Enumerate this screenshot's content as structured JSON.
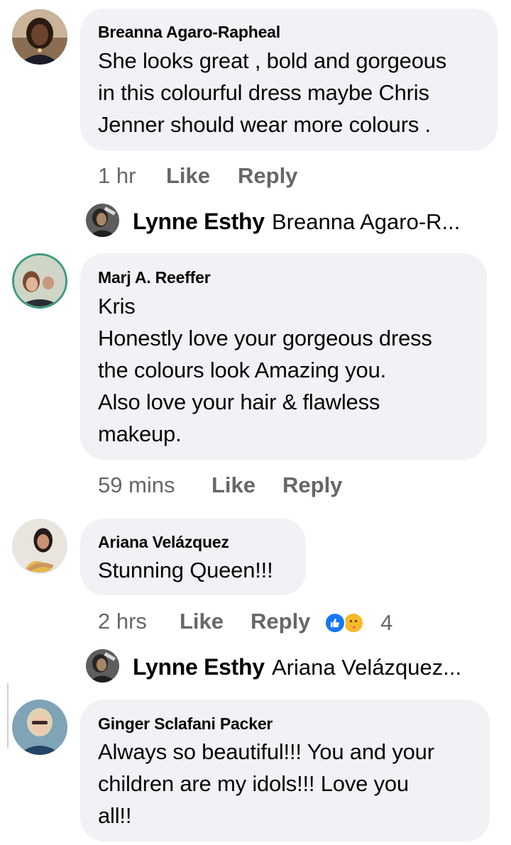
{
  "comments": [
    {
      "author": "Breanna Agaro-Rapheal",
      "text": "She looks great , bold and gorgeous\nin this colourful dress maybe Chris\nJenner should wear more colours .",
      "time": "1 hr",
      "like_label": "Like",
      "reply_label": "Reply",
      "reply_preview": {
        "author": "Lynne Esthy",
        "text": "Breanna Agaro-R..."
      }
    },
    {
      "author": "Marj A. Reeffer",
      "text": "Kris\nHonestly love your gorgeous dress\nthe colours look Amazing you.\nAlso love your hair & flawless\nmakeup.",
      "time": "59 mins",
      "like_label": "Like",
      "reply_label": "Reply"
    },
    {
      "author": "Ariana Velázquez",
      "text": "Stunning Queen!!!",
      "time": "2 hrs",
      "like_label": "Like",
      "reply_label": "Reply",
      "reaction_count": "4",
      "reactions": [
        "like-icon",
        "care-icon"
      ],
      "reply_preview": {
        "author": "Lynne Esthy",
        "text": "Ariana Velázquez..."
      }
    },
    {
      "author": "Ginger Sclafani Packer",
      "text": "Always so beautiful!!! You and your\nchildren are my idols!!! Love you\nall!!"
    }
  ],
  "colors": {
    "bubble": "#f0f2f5",
    "secondary_text": "#65676b",
    "like_blue": "#1877f2",
    "care_yellow": "#f7b928"
  }
}
